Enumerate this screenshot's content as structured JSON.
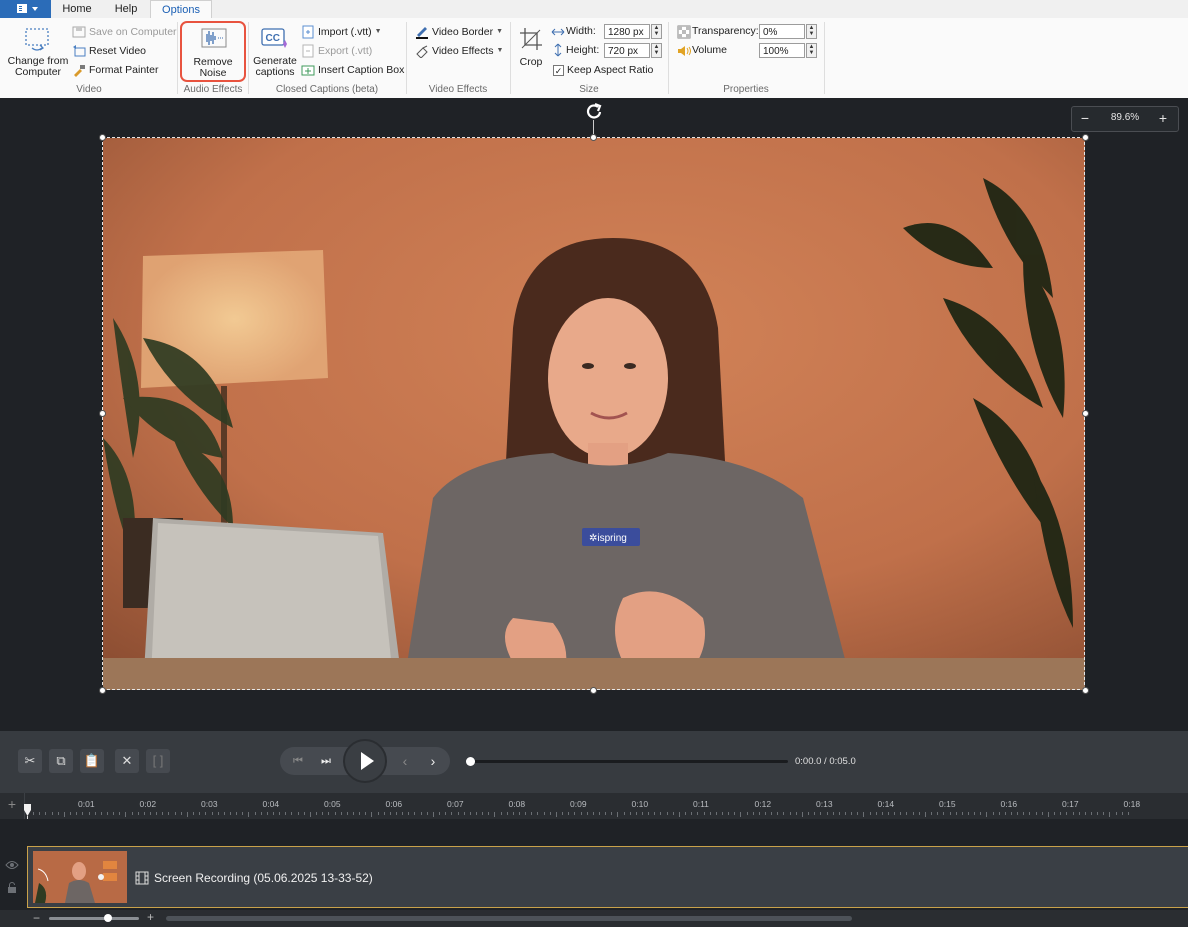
{
  "tabs": {
    "home": "Home",
    "help": "Help",
    "options": "Options"
  },
  "ribbon": {
    "video": {
      "label": "Video",
      "change_from_computer": "Change from Computer",
      "save_on_computer": "Save on Computer",
      "reset_video": "Reset Video",
      "format_painter": "Format Painter"
    },
    "audio_effects": {
      "label": "Audio Effects",
      "remove_noise": "Remove Noise"
    },
    "captions": {
      "label": "Closed Captions (beta)",
      "generate_captions": "Generate captions",
      "import": "Import (.vtt)",
      "export": "Export (.vtt)",
      "insert_caption_box": "Insert Caption Box"
    },
    "video_effects": {
      "label": "Video Effects",
      "video_border": "Video Border",
      "video_effects": "Video Effects"
    },
    "size": {
      "label": "Size",
      "crop": "Crop",
      "width_label": "Width:",
      "width_value": "1280 px",
      "height_label": "Height:",
      "height_value": "720 px",
      "keep_aspect_ratio": "Keep Aspect Ratio",
      "keep_aspect_checked": true
    },
    "properties": {
      "label": "Properties",
      "transparency_label": "Transparency:",
      "transparency_value": "0%",
      "volume_label": "Volume",
      "volume_value": "100%"
    }
  },
  "canvas": {
    "zoom_value": "89.6%",
    "zoom_out": "−",
    "zoom_in": "+",
    "shirt_logo": "ispring"
  },
  "player": {
    "time_readout": "0:00.0 / 0:05.0"
  },
  "timeline": {
    "ticks": [
      "0:01",
      "0:02",
      "0:03",
      "0:04",
      "0:05",
      "0:06",
      "0:07",
      "0:08",
      "0:09",
      "0:10",
      "0:11",
      "0:12",
      "0:13",
      "0:14",
      "0:15",
      "0:16",
      "0:17",
      "0:18"
    ],
    "clip_title": "Screen Recording (05.06.2025 13-33-52)",
    "add_track": "+",
    "zoom_minus": "−",
    "zoom_plus": "+"
  },
  "colors": {
    "accent": "#2b6cb8",
    "highlight": "#e8533f",
    "clip_border": "#c9a24a",
    "canvas_bg": "#1f2226",
    "video_wall": "#c8774f"
  }
}
